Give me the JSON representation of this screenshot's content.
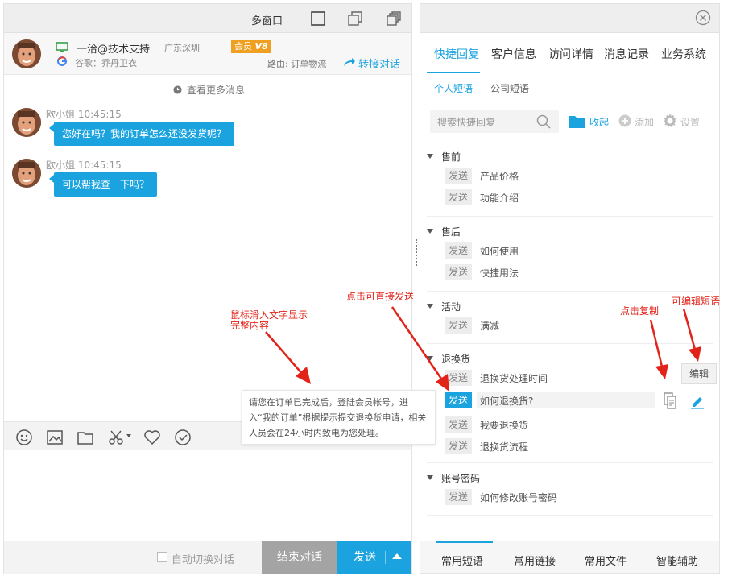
{
  "chat": {
    "multiwindow_label": "多窗口",
    "customer": {
      "name": "一洽@技术支持",
      "location": "广东深圳",
      "member_badge": "会员",
      "member_level": "V8",
      "source": "谷歌：乔丹卫衣",
      "route": "路由: 订单物流",
      "transfer_label": "转接对话"
    },
    "view_more": "查看更多消息",
    "messages": [
      {
        "sender": "欧小姐",
        "time": "10:45:15",
        "text": "您好在吗？我的订单怎么还没发货呢？"
      },
      {
        "sender": "欧小姐",
        "time": "10:45:15",
        "text": "可以帮我查一下吗？"
      }
    ],
    "auto_switch_label": "自动切换对话",
    "end_label": "结束对话",
    "send_label": "发送"
  },
  "panel": {
    "tabs": [
      "快捷回复",
      "客户信息",
      "访问详情",
      "消息记录",
      "业务系统"
    ],
    "subtabs": [
      "个人短语",
      "公司短语"
    ],
    "search_placeholder": "搜索快捷回复",
    "collapse_label": "收起",
    "add_label": "添加",
    "settings_label": "设置",
    "send_label": "发送",
    "groups": [
      {
        "title": "售前",
        "items": [
          "产品价格",
          "功能介绍"
        ]
      },
      {
        "title": "售后",
        "items": [
          "如何使用",
          "快捷用法"
        ]
      },
      {
        "title": "活动",
        "items": [
          "满减"
        ]
      },
      {
        "title": "退换货",
        "items": [
          "退换货处理时间",
          "如何退换货?",
          "我要退换货",
          "退换货流程"
        ]
      },
      {
        "title": "账号密码",
        "items": [
          "如何修改账号密码"
        ]
      }
    ],
    "edit_tooltip": "编辑",
    "bottom_tabs": [
      "常用短语",
      "常用链接",
      "常用文件",
      "智能辅助"
    ],
    "preview_tooltip": "请您在订单已完成后，登陆会员帐号，进入“我的订单”根据提示提交退换货申请，相关人员会在24小时内致电为您处理。"
  },
  "annotations": {
    "hover_hint_line1": "鼠标滑入文字显示",
    "hover_hint_line2": "完整内容",
    "click_send": "点击可直接发送",
    "click_copy": "点击复制",
    "editable": "可编辑短语"
  },
  "colors": {
    "accent": "#1ba3e0",
    "annotation": "#e2231a",
    "badge": "#f0a020"
  }
}
